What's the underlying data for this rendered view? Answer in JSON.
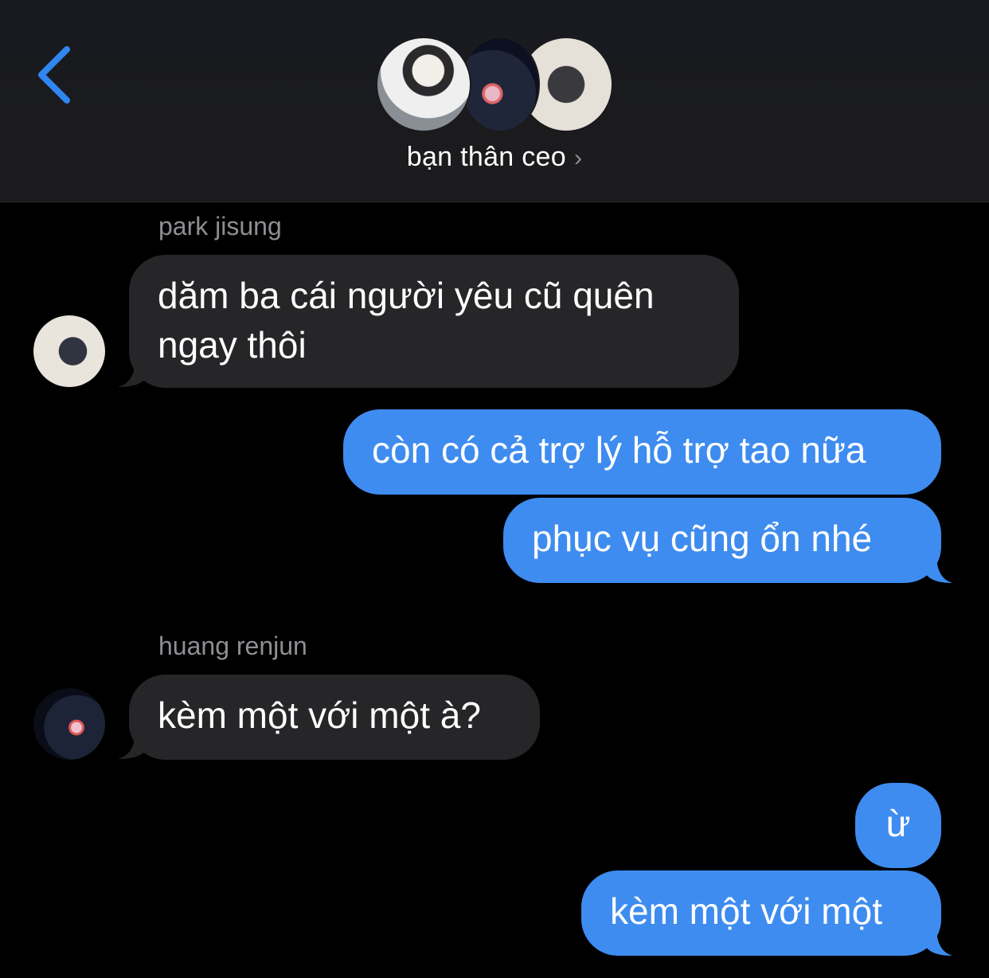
{
  "header": {
    "group_name": "bạn thân ceo",
    "chevron": "›",
    "back_icon": "chevron-left-icon",
    "accent": "#2f86f0"
  },
  "messages": [
    {
      "sender": "park jisung",
      "text_lines": [
        "dăm ba cái người yêu cũ quên",
        "ngay thôi"
      ],
      "direction": "incoming"
    },
    {
      "text": "còn có cả trợ lý hỗ trợ tao nữa",
      "direction": "outgoing"
    },
    {
      "text": "phục vụ cũng ổn nhé",
      "direction": "outgoing"
    },
    {
      "sender": "huang renjun",
      "text": "kèm một với một à?",
      "direction": "incoming"
    },
    {
      "text": "ừ",
      "direction": "outgoing"
    },
    {
      "text": "kèm một với một",
      "direction": "outgoing"
    }
  ],
  "colors": {
    "incoming_bubble": "#262628",
    "outgoing_bubble": "#3e8cf0",
    "sender_text": "#8e8e93"
  }
}
